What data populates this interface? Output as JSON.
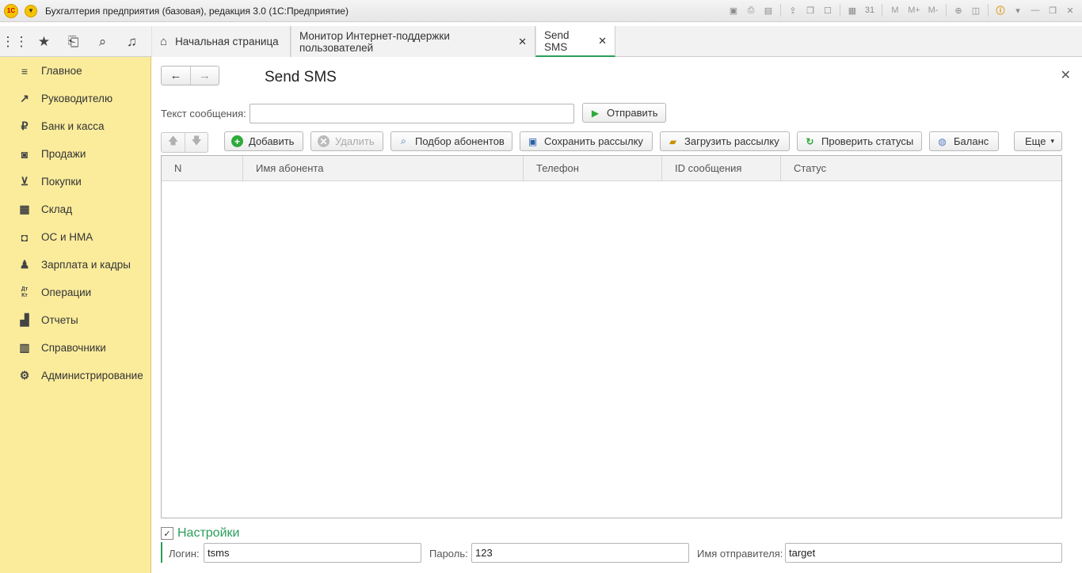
{
  "window": {
    "title": "Бухгалтерия предприятия (базовая), редакция 3.0  (1С:Предприятие)",
    "logo_text": "1С",
    "tool_m": "M",
    "tool_mplus": "M+",
    "tool_mminus": "M-",
    "calendar_day": "31"
  },
  "tabs": [
    {
      "label": "Начальная страница"
    },
    {
      "label": "Монитор Интернет-поддержки пользователей"
    },
    {
      "label": "Send SMS"
    }
  ],
  "sidebar": {
    "items": [
      {
        "label": "Главное",
        "icon": "menu-icon"
      },
      {
        "label": "Руководителю",
        "icon": "trend-icon"
      },
      {
        "label": "Банк и касса",
        "icon": "ruble-icon"
      },
      {
        "label": "Продажи",
        "icon": "bag-icon"
      },
      {
        "label": "Покупки",
        "icon": "cart-icon"
      },
      {
        "label": "Склад",
        "icon": "warehouse-icon"
      },
      {
        "label": "ОС и НМА",
        "icon": "truck-icon"
      },
      {
        "label": "Зарплата и кадры",
        "icon": "person-icon"
      },
      {
        "label": "Операции",
        "icon": "dt-kt-icon",
        "glyph": "Дт Кт"
      },
      {
        "label": "Отчеты",
        "icon": "bar-chart-icon"
      },
      {
        "label": "Справочники",
        "icon": "books-icon"
      },
      {
        "label": "Администрирование",
        "icon": "gear-icon"
      }
    ]
  },
  "form": {
    "title": "Send SMS",
    "message_label": "Текст сообщения:",
    "message_value": "",
    "send_label": "Отправить",
    "toolbar": {
      "add": "Добавить",
      "delete": "Удалить",
      "pick": "Подбор абонентов",
      "save": "Сохранить рассылку",
      "load": "Загрузить рассылку",
      "check": "Проверить статусы",
      "balance": "Баланс",
      "more": "Еще"
    },
    "columns": [
      "N",
      "Имя абонента",
      "Телефон",
      "ID сообщения",
      "Статус"
    ],
    "rows": [],
    "settings": {
      "title": "Настройки",
      "login_label": "Логин:",
      "login_value": "tsms",
      "password_label": "Пароль:",
      "password_value": "123",
      "sender_label": "Имя отправителя:",
      "sender_value": "target"
    }
  },
  "colors": {
    "sidebar_bg": "#fbec9c",
    "accent_green": "#2a9d5a"
  }
}
